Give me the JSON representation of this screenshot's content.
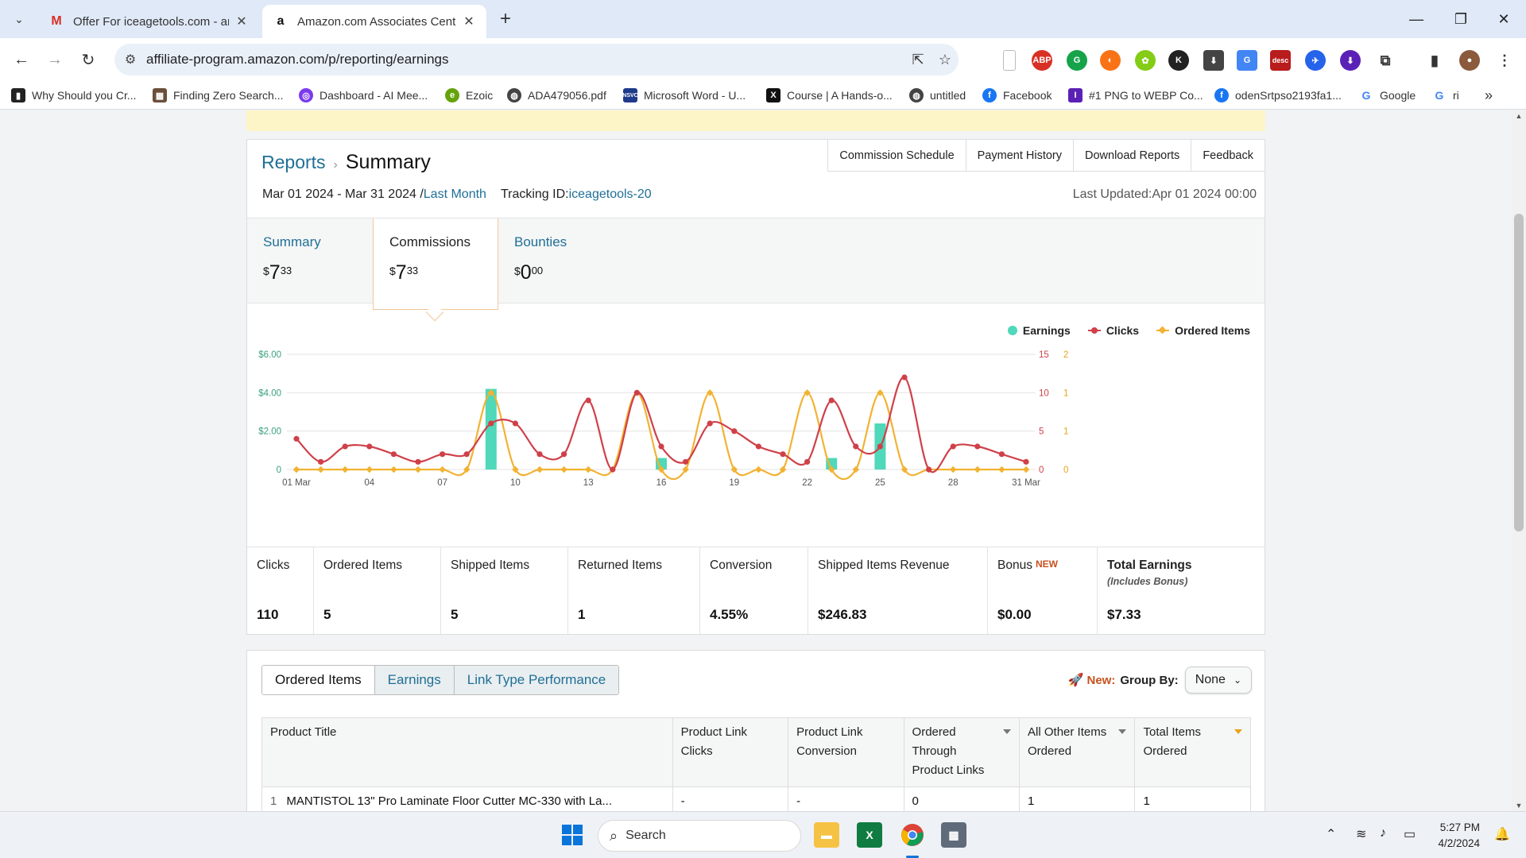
{
  "browser": {
    "tabs": [
      {
        "title": "Offer For iceagetools.com - am",
        "favicon": "gmail-icon",
        "active": false
      },
      {
        "title": "Amazon.com Associates Centra",
        "favicon": "amazon-icon",
        "active": true
      }
    ],
    "url": "affiliate-program.amazon.com/p/reporting/earnings",
    "bookmarks": [
      {
        "label": "Why Should you Cr...",
        "icon": "bar-chart-icon"
      },
      {
        "label": "Finding Zero Search...",
        "icon": "image-icon"
      },
      {
        "label": "Dashboard - AI Mee...",
        "icon": "ai-icon"
      },
      {
        "label": "Ezoic",
        "icon": "ezoic-icon"
      },
      {
        "label": "ADA479056.pdf",
        "icon": "globe-icon"
      },
      {
        "label": "Microsoft Word - U...",
        "icon": "nsvc-icon"
      },
      {
        "label": "Course | A Hands-o...",
        "icon": "x-icon"
      },
      {
        "label": "untitled",
        "icon": "globe-icon"
      },
      {
        "label": "Facebook",
        "icon": "facebook-icon"
      },
      {
        "label": "#1 PNG to WEBP Co...",
        "icon": "converter-icon"
      },
      {
        "label": "odenSrtpso2193fa1...",
        "icon": "facebook-icon"
      },
      {
        "label": "Google",
        "icon": "google-icon"
      },
      {
        "label": "ri",
        "icon": "google-icon"
      }
    ]
  },
  "page": {
    "breadcrumb": {
      "parent": "Reports",
      "current": "Summary"
    },
    "top_links": [
      "Commission Schedule",
      "Payment History",
      "Download Reports",
      "Feedback"
    ],
    "date_range": "Mar 01 2024 - Mar 31 2024 /",
    "date_range_link": "Last Month",
    "tracking_label": "Tracking ID:",
    "tracking_id": "iceagetools-20",
    "last_updated": "Last Updated:Apr 01 2024 00:00",
    "metric_tabs": [
      {
        "label": "Summary",
        "currency": "$",
        "whole": "7",
        "cents": "33"
      },
      {
        "label": "Commissions",
        "currency": "$",
        "whole": "7",
        "cents": "33"
      },
      {
        "label": "Bounties",
        "currency": "$",
        "whole": "0",
        "cents": "00"
      }
    ],
    "legend": [
      "Earnings",
      "Clicks",
      "Ordered Items"
    ],
    "stats": [
      {
        "label": "Clicks",
        "value": "110"
      },
      {
        "label": "Ordered Items",
        "value": "5"
      },
      {
        "label": "Shipped Items",
        "value": "5"
      },
      {
        "label": "Returned Items",
        "value": "1"
      },
      {
        "label": "Conversion",
        "value": "4.55%"
      },
      {
        "label": "Shipped Items Revenue",
        "value": "$246.83"
      },
      {
        "label": "Bonus",
        "tag": "NEW",
        "value": "$0.00"
      },
      {
        "label": "Total Earnings",
        "sub": "(Includes Bonus)",
        "value": "$7.33"
      }
    ],
    "report_tabs": [
      "Ordered Items",
      "Earnings",
      "Link Type Performance"
    ],
    "group_by": {
      "new_label": "New:",
      "label": "Group By:",
      "value": "None"
    },
    "table": {
      "headers": [
        "Product Title",
        "Product Link Clicks",
        "Product Link Conversion",
        "Ordered Through Product Links",
        "All Other Items Ordered",
        "Total Items Ordered"
      ],
      "rows": [
        {
          "num": "1",
          "title": "MANTISTOL 13\" Pro Laminate Floor Cutter MC-330 with La...",
          "clicks": "-",
          "conversion": "-",
          "through": "0",
          "other": "1",
          "total": "1"
        }
      ]
    }
  },
  "chart_data": {
    "type": "bar+line",
    "x": [
      "01 Mar",
      "02 Mar",
      "03 Mar",
      "04 Mar",
      "05 Mar",
      "06 Mar",
      "07 Mar",
      "08 Mar",
      "09 Mar",
      "10 Mar",
      "11 Mar",
      "12 Mar",
      "13 Mar",
      "14 Mar",
      "15 Mar",
      "16 Mar",
      "17 Mar",
      "18 Mar",
      "19 Mar",
      "20 Mar",
      "21 Mar",
      "22 Mar",
      "23 Mar",
      "24 Mar",
      "25 Mar",
      "26 Mar",
      "27 Mar",
      "28 Mar",
      "29 Mar",
      "30 Mar",
      "31 Mar"
    ],
    "x_tick_labels": [
      "01 Mar",
      "04",
      "07",
      "10",
      "13",
      "16",
      "19",
      "22",
      "25",
      "28",
      "31 Mar"
    ],
    "series": [
      {
        "name": "Earnings",
        "type": "bar",
        "axis": "left",
        "color": "#4fd8b9",
        "values": [
          0,
          0,
          0,
          0,
          0,
          0,
          0,
          0,
          4.2,
          0,
          0,
          0,
          0,
          0,
          0,
          0.6,
          0,
          0,
          0,
          0,
          0,
          0,
          0.6,
          0,
          2.4,
          0,
          0,
          0,
          0,
          0,
          0
        ]
      },
      {
        "name": "Clicks",
        "type": "line",
        "axis": "right1",
        "color": "#cf4049",
        "values": [
          4,
          1,
          3,
          3,
          2,
          1,
          2,
          2,
          6,
          6,
          2,
          2,
          9,
          0,
          10,
          3,
          1,
          6,
          5,
          3,
          2,
          1,
          9,
          3,
          3,
          12,
          0,
          3,
          3,
          2,
          1
        ]
      },
      {
        "name": "Ordered Items",
        "type": "line",
        "axis": "right2",
        "color": "#f2b233",
        "values": [
          0,
          0,
          0,
          0,
          0,
          0,
          0,
          0,
          1,
          0,
          0,
          0,
          0,
          0,
          1,
          0,
          0,
          1,
          0,
          0,
          0,
          1,
          0,
          0,
          1,
          0,
          0,
          0,
          0,
          0,
          0
        ]
      }
    ],
    "y_left": {
      "ticks": [
        "0",
        "$2.00",
        "$4.00",
        "$6.00"
      ],
      "range": [
        0,
        6
      ],
      "color": "#3aa17e"
    },
    "y_right1": {
      "ticks": [
        "0",
        "5",
        "10",
        "15"
      ],
      "range": [
        0,
        15
      ],
      "color": "#cf4049"
    },
    "y_right2": {
      "ticks": [
        "0",
        "1",
        "1",
        "2"
      ],
      "range": [
        0,
        1.5
      ],
      "color": "#e8a317"
    },
    "grid": true,
    "legend_position": "top-right"
  },
  "taskbar": {
    "search_placeholder": "Search",
    "time": "5:27 PM",
    "date": "4/2/2024"
  }
}
